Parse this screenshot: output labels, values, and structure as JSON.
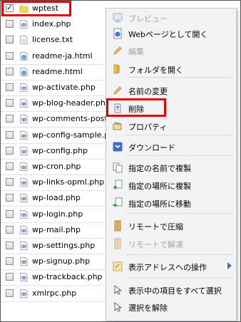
{
  "files": [
    {
      "name": "wptest",
      "type": "folder",
      "checked": true
    },
    {
      "name": "index.php",
      "type": "php",
      "checked": false
    },
    {
      "name": "license.txt",
      "type": "txt",
      "checked": false
    },
    {
      "name": "readme-ja.html",
      "type": "html",
      "checked": false
    },
    {
      "name": "readme.html",
      "type": "html",
      "checked": false
    },
    {
      "name": "wp-activate.php",
      "type": "php",
      "checked": false
    },
    {
      "name": "wp-blog-header.php",
      "type": "php",
      "checked": false
    },
    {
      "name": "wp-comments-post.php",
      "type": "php",
      "checked": false
    },
    {
      "name": "wp-config-sample.php",
      "type": "php",
      "checked": false
    },
    {
      "name": "wp-config.php",
      "type": "php",
      "checked": false
    },
    {
      "name": "wp-cron.php",
      "type": "php",
      "checked": false
    },
    {
      "name": "wp-links-opml.php",
      "type": "php",
      "checked": false
    },
    {
      "name": "wp-load.php",
      "type": "php",
      "checked": false
    },
    {
      "name": "wp-login.php",
      "type": "php",
      "checked": false
    },
    {
      "name": "wp-mail.php",
      "type": "php",
      "checked": false
    },
    {
      "name": "wp-settings.php",
      "type": "php",
      "checked": false
    },
    {
      "name": "wp-signup.php",
      "type": "php",
      "checked": false
    },
    {
      "name": "wp-trackback.php",
      "type": "php",
      "checked": false
    },
    {
      "name": "xmlrpc.php",
      "type": "php",
      "checked": false
    }
  ],
  "context_menu": {
    "items": [
      {
        "label": "プレビュー",
        "icon": "monitor-icon",
        "disabled": true
      },
      {
        "label": "Webページとして開く",
        "icon": "globe-icon",
        "disabled": false
      },
      {
        "label": "編集",
        "icon": "pencil-icon",
        "disabled": true
      },
      {
        "label": "フォルダを開く",
        "icon": "folder-open-icon",
        "disabled": false
      },
      {
        "label": "名前の変更",
        "icon": "pencil-icon",
        "disabled": false
      },
      {
        "label": "削除",
        "icon": "trash-icon",
        "disabled": false
      },
      {
        "label": "プロパティ",
        "icon": "properties-icon",
        "disabled": false
      },
      {
        "label": "ダウンロード",
        "icon": "download-icon",
        "disabled": false
      },
      {
        "label": "指定の名前で複製",
        "icon": "copy-icon",
        "disabled": false
      },
      {
        "label": "指定の場所に複製",
        "icon": "copy-to-icon",
        "disabled": false
      },
      {
        "label": "指定の場所に移動",
        "icon": "move-to-icon",
        "disabled": false
      },
      {
        "label": "リモートで圧縮",
        "icon": "zip-icon",
        "disabled": false
      },
      {
        "label": "リモートで解凍",
        "icon": "unzip-icon",
        "disabled": true
      },
      {
        "label": "表示アドレスへの操作",
        "icon": "address-icon",
        "disabled": false
      },
      {
        "label": "表示中の項目をすべて選択",
        "icon": "cursor-icon",
        "disabled": false
      },
      {
        "label": "選択を解除",
        "icon": "cursor-icon",
        "disabled": false
      }
    ]
  },
  "colors": {
    "highlight": "#e30000",
    "menu_bg": "#f1f3f5",
    "submenu_arrow": "#3a72c9"
  }
}
